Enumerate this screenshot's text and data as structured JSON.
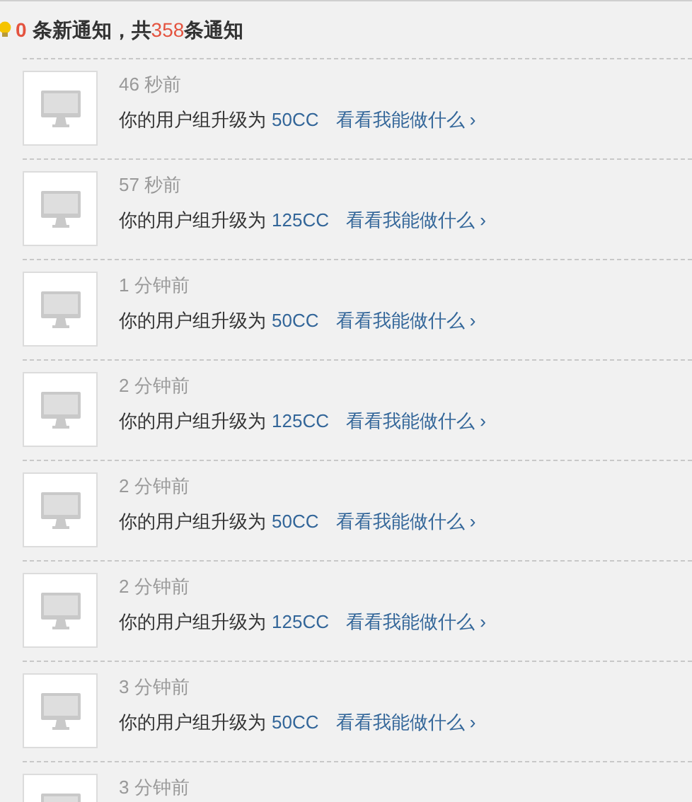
{
  "header": {
    "new_count": "0",
    "text_1": "条新通知，共",
    "total": "358",
    "text_2": "条通知"
  },
  "notifications": [
    {
      "time": "46 秒前",
      "message": "你的用户组升级为",
      "group": "50CC",
      "link": "看看我能做什么 ›"
    },
    {
      "time": "57 秒前",
      "message": "你的用户组升级为",
      "group": "125CC",
      "link": "看看我能做什么 ›"
    },
    {
      "time": "1 分钟前",
      "message": "你的用户组升级为",
      "group": "50CC",
      "link": "看看我能做什么 ›"
    },
    {
      "time": "2 分钟前",
      "message": "你的用户组升级为",
      "group": "125CC",
      "link": "看看我能做什么 ›"
    },
    {
      "time": "2 分钟前",
      "message": "你的用户组升级为",
      "group": "50CC",
      "link": "看看我能做什么 ›"
    },
    {
      "time": "2 分钟前",
      "message": "你的用户组升级为",
      "group": "125CC",
      "link": "看看我能做什么 ›"
    },
    {
      "time": "3 分钟前",
      "message": "你的用户组升级为",
      "group": "50CC",
      "link": "看看我能做什么 ›"
    },
    {
      "time": "3 分钟前"
    }
  ]
}
